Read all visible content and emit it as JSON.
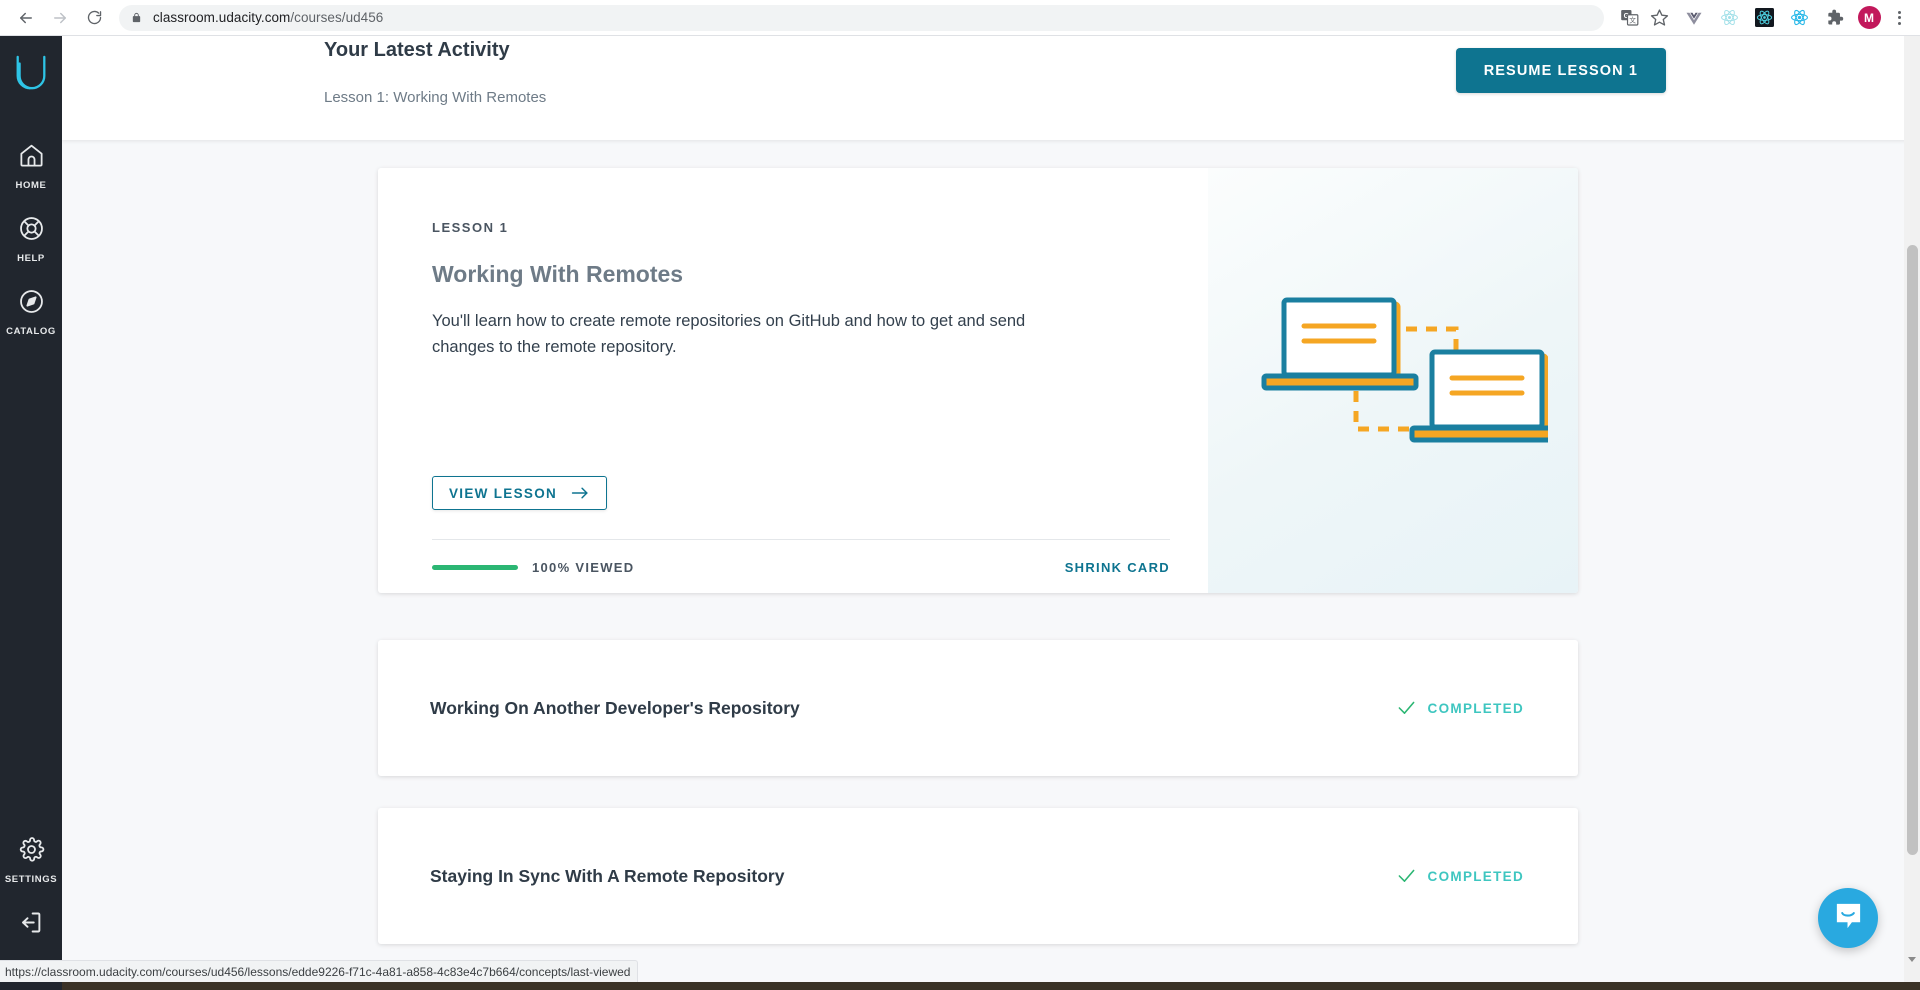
{
  "browser": {
    "back_icon": "back-arrow-icon",
    "forward_icon": "forward-arrow-icon",
    "reload_icon": "reload-icon",
    "lock_icon": "lock-icon",
    "url_host": "classroom.udacity.com",
    "url_path": "/courses/ud456",
    "url_full": "classroom.udacity.com/courses/ud456",
    "extensions": [
      {
        "name": "google-translate-icon",
        "label": "G"
      },
      {
        "name": "bookmark-star-icon",
        "label": ""
      },
      {
        "name": "vue-devtools-icon",
        "label": "V"
      },
      {
        "name": "react-devtools-light-icon",
        "label": ""
      },
      {
        "name": "react-devtools-dark-icon",
        "label": ""
      },
      {
        "name": "react-devtools-blue-icon",
        "label": ""
      },
      {
        "name": "extensions-puzzle-icon",
        "label": ""
      }
    ],
    "profile_initial": "M",
    "menu_icon": "three-dot-menu-icon",
    "status_bar_url": "https://classroom.udacity.com/courses/ud456/lessons/edde9226-f71c-4a81-a858-4c83e4c7b664/concepts/last-viewed"
  },
  "sidebar": {
    "logo": "udacity-logo",
    "items": [
      {
        "label": "HOME",
        "icon": "home-icon"
      },
      {
        "label": "HELP",
        "icon": "lifebuoy-icon"
      },
      {
        "label": "CATALOG",
        "icon": "compass-icon"
      }
    ],
    "bottom_items": [
      {
        "label": "SETTINGS",
        "icon": "gear-icon"
      },
      {
        "label": "",
        "icon": "logout-icon"
      }
    ]
  },
  "header": {
    "title": "Your Latest Activity",
    "subtitle": "Lesson 1: Working With Remotes",
    "resume_label": "RESUME LESSON 1"
  },
  "lesson_card": {
    "eyebrow": "LESSON 1",
    "title": "Working With Remotes",
    "description": "You'll learn how to create remote repositories on GitHub and how to get and send changes to the remote repository.",
    "view_lesson_label": "VIEW LESSON",
    "view_lesson_icon": "arrow-right-icon",
    "progress_percent": 100,
    "progress_label": "100% VIEWED",
    "shrink_card_label": "SHRINK CARD",
    "illustration": "two-laptops-syncing-illustration"
  },
  "lessons": [
    {
      "title": "Working On Another Developer's Repository",
      "status": "COMPLETED",
      "status_icon": "check-icon"
    },
    {
      "title": "Staying In Sync With A Remote Repository",
      "status": "COMPLETED",
      "status_icon": "check-icon"
    }
  ],
  "widgets": {
    "intercom_launcher_icon": "chat-bubble-icon"
  },
  "colors": {
    "accent_teal": "#0e7490",
    "sidebar_bg": "#21262e",
    "progress_green": "#2bb673",
    "completed_teal": "#3ec6c0",
    "udacity_cyan": "#2ec4e6",
    "intercom_blue": "#29a9e0",
    "page_bg": "#f7f8fa"
  }
}
